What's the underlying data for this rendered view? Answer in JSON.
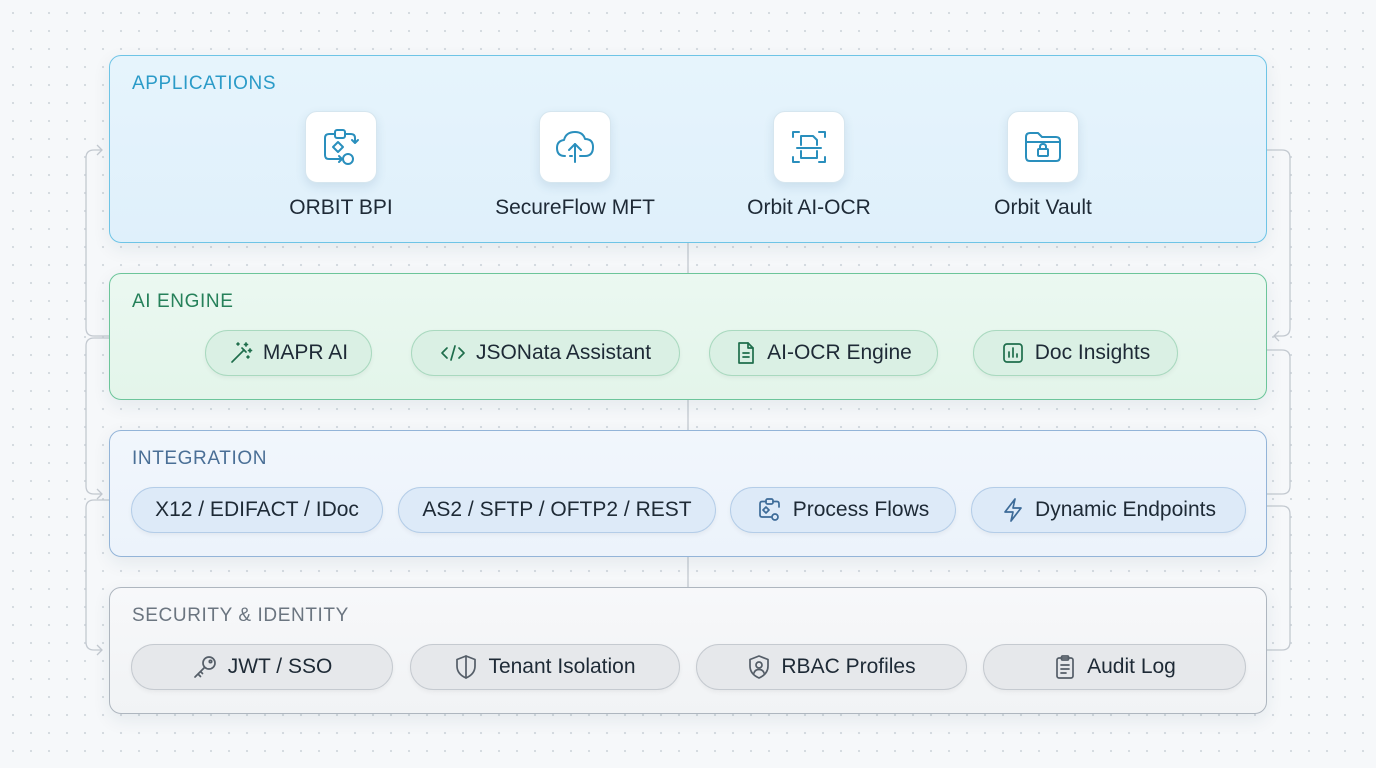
{
  "layers": {
    "applications": {
      "title": "APPLICATIONS",
      "apps": [
        {
          "label": "ORBIT BPI",
          "icon": "workflow-icon"
        },
        {
          "label": "SecureFlow MFT",
          "icon": "cloud-upload-icon"
        },
        {
          "label": "Orbit AI-OCR",
          "icon": "document-scan-icon"
        },
        {
          "label": "Orbit Vault",
          "icon": "folder-lock-icon"
        }
      ]
    },
    "ai_engine": {
      "title": "AI ENGINE",
      "items": [
        {
          "label": "MAPR AI",
          "icon": "magic-wand-icon"
        },
        {
          "label": "JSONata Assistant",
          "icon": "code-icon"
        },
        {
          "label": "AI-OCR Engine",
          "icon": "document-icon"
        },
        {
          "label": "Doc Insights",
          "icon": "bar-chart-icon"
        }
      ]
    },
    "integration": {
      "title": "INTEGRATION",
      "items": [
        {
          "label": "X12 / EDIFACT / IDoc",
          "icon": ""
        },
        {
          "label": "AS2 / SFTP / OFTP2 / REST",
          "icon": ""
        },
        {
          "label": "Process Flows",
          "icon": "flow-icon"
        },
        {
          "label": "Dynamic Endpoints",
          "icon": "lightning-icon"
        }
      ]
    },
    "security": {
      "title": "SECURITY & IDENTITY",
      "items": [
        {
          "label": "JWT / SSO",
          "icon": "key-icon"
        },
        {
          "label": "Tenant Isolation",
          "icon": "shield-icon"
        },
        {
          "label": "RBAC Profiles",
          "icon": "shield-user-icon"
        },
        {
          "label": "Audit Log",
          "icon": "clipboard-icon"
        }
      ]
    }
  },
  "colors": {
    "applications_accent": "#2b9bc8",
    "ai_engine_accent": "#26815a",
    "integration_accent": "#4a6f96",
    "security_accent": "#6b7580"
  }
}
